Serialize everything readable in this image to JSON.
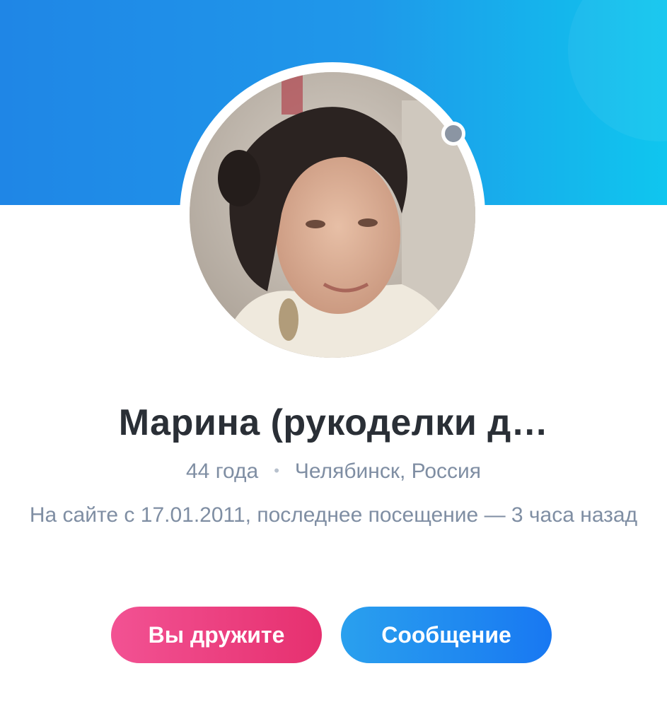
{
  "profile": {
    "name": "Марина (рукоделки д…",
    "age": "44 года",
    "separator": "•",
    "location": "Челябинск, Россия",
    "last_seen": "На сайте с 17.01.2011, последнее посещение — 3 часа назад",
    "online_status_color": "#8b95a3"
  },
  "actions": {
    "friends_label": "Вы дружите",
    "message_label": "Сообщение"
  },
  "colors": {
    "cover_gradient_start": "#1f86e6",
    "cover_gradient_end": "#0fc6ef",
    "friends_button": "#e6306f",
    "message_button": "#1878f2",
    "name_text": "#2a2f36",
    "meta_text": "#7f8ea3"
  },
  "icons": {
    "status_dot": "status-dot-icon"
  }
}
